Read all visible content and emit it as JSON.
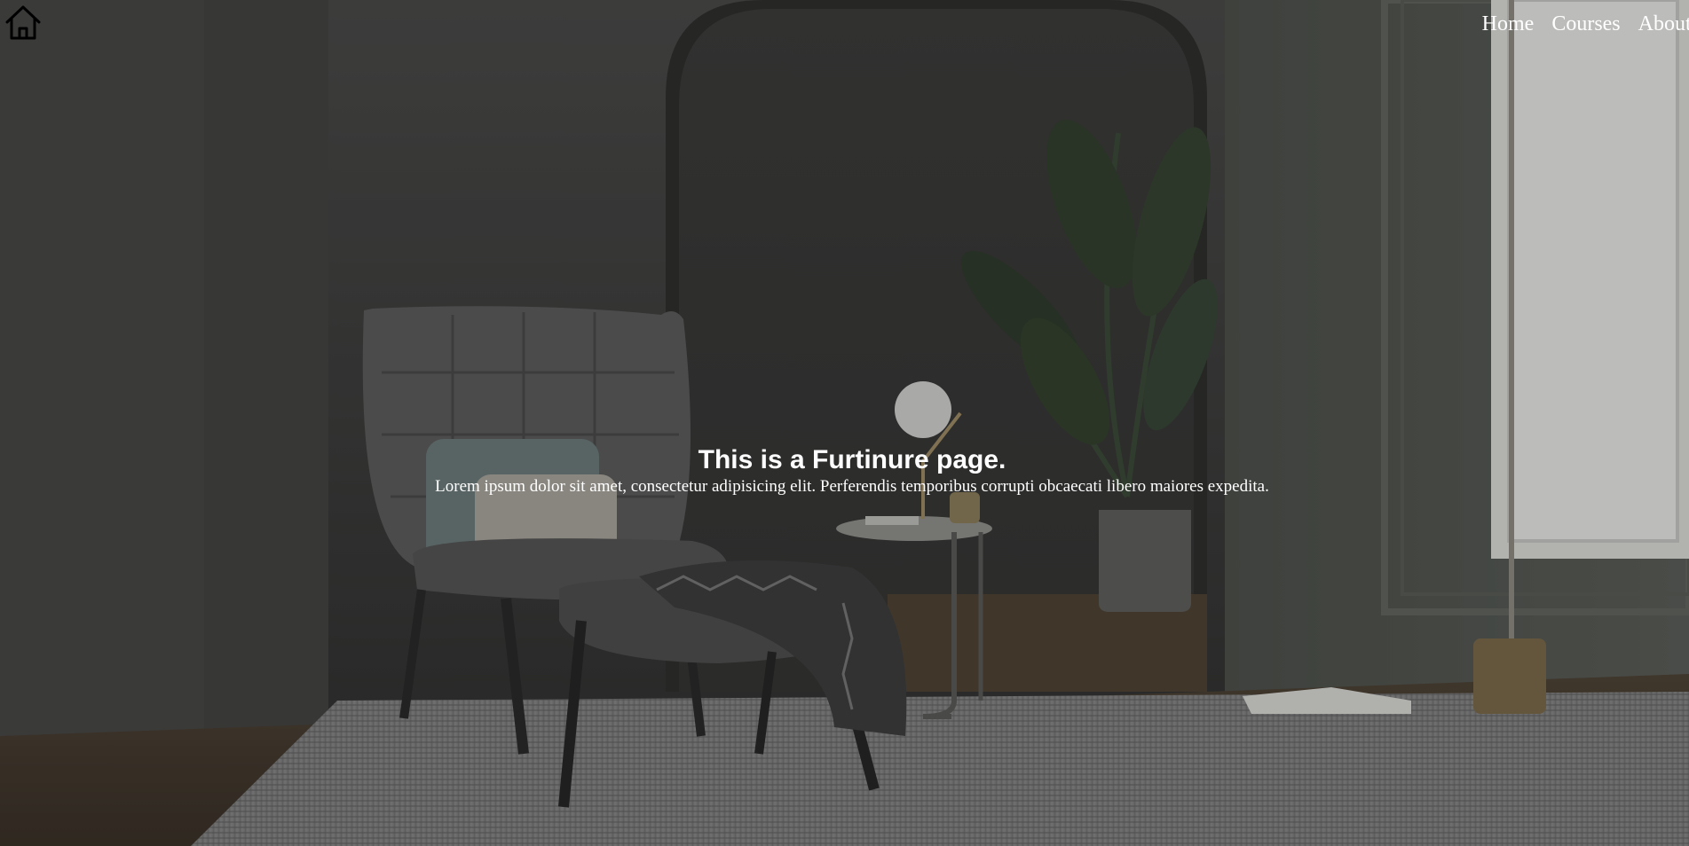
{
  "header": {
    "logo_icon": "home-icon",
    "nav": [
      {
        "label": "Home"
      },
      {
        "label": "Courses"
      },
      {
        "label": "About us"
      }
    ]
  },
  "hero": {
    "title": "This is a Furtinure page.",
    "description": "Lorem ipsum dolor sit amet, consectetur adipisicing elit. Perferendis temporibus corrupti obcaecati libero maiores expedita.",
    "background_image": "interior-scene-armchair-ottoman-side-table-lamp-plant-rug",
    "text_color": "#ffffff"
  }
}
